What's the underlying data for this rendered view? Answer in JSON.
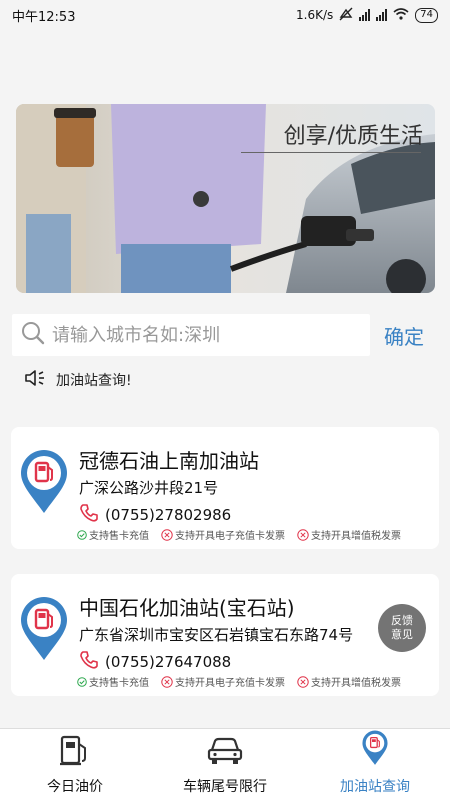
{
  "status_bar": {
    "time": "中午12:53",
    "net_speed": "1.6K/s",
    "battery": "74"
  },
  "banner": {
    "caption": "创享/优质生活"
  },
  "search": {
    "placeholder": "请输入城市名如:深圳",
    "confirm_label": "确定"
  },
  "notice": {
    "text": "加油站查询!",
    "icon": "speaker-icon"
  },
  "stations": [
    {
      "name": "冠德石油上南加油站",
      "address": "广深公路沙井段21号",
      "phone": "(0755)27802986",
      "features": [
        {
          "label": "支持售卡充值",
          "supported": true
        },
        {
          "label": "支持开具电子充值卡发票",
          "supported": false
        },
        {
          "label": "支持开具增值税发票",
          "supported": false
        }
      ]
    },
    {
      "name": "中国石化加油站(宝石站)",
      "address": "广东省深圳市宝安区石岩镇宝石东路74号",
      "phone": "(0755)27647088",
      "features": [
        {
          "label": "支持售卡充值",
          "supported": true
        },
        {
          "label": "支持开具电子充值卡发票",
          "supported": false
        },
        {
          "label": "支持开具增值税发票",
          "supported": false
        }
      ]
    }
  ],
  "feedback": {
    "line1": "反馈",
    "line2": "意见"
  },
  "tabs": [
    {
      "label": "今日油价",
      "icon": "fuel-pump-icon",
      "active": false
    },
    {
      "label": "车辆尾号限行",
      "icon": "car-icon",
      "active": false
    },
    {
      "label": "加油站查询",
      "icon": "gas-station-pin-icon",
      "active": true
    }
  ],
  "colors": {
    "accent": "#3a82c4",
    "pin_blue": "#3a82c4",
    "pin_red": "#e0344a",
    "ok_green": "#2ea84f",
    "no_red": "#e0344a"
  }
}
